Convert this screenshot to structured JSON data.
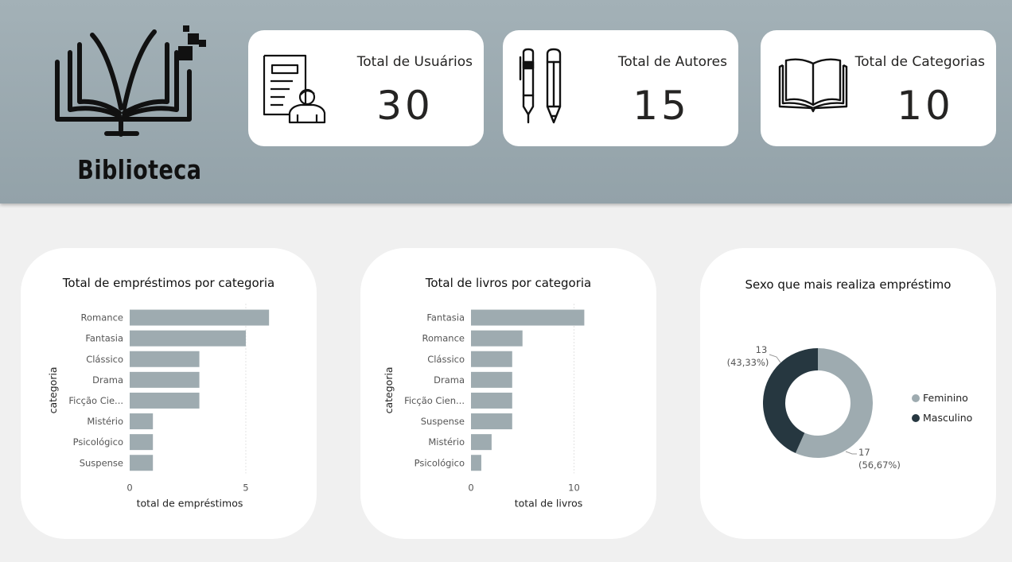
{
  "header": {
    "logo_text": "Biblioteca",
    "background_color": "#9eadb3"
  },
  "kpis": [
    {
      "label": "Total de Usuários",
      "value": "30",
      "icon": "user-document-icon"
    },
    {
      "label": "Total de Autores",
      "value": "15",
      "icon": "pen-pencil-icon"
    },
    {
      "label": "Total de Categorias",
      "value": "10",
      "icon": "open-book-icon"
    }
  ],
  "colors": {
    "bar": "#9eabb0",
    "feminino": "#9eabb0",
    "masculino": "#263740"
  },
  "chart_data": [
    {
      "type": "bar",
      "orientation": "horizontal",
      "title": "Total de empréstimos por categoria",
      "xlabel": "total de empréstimos",
      "ylabel": "categoria",
      "categories": [
        "Romance",
        "Fantasia",
        "Clássico",
        "Drama",
        "Ficção Cie...",
        "Mistério",
        "Psicológico",
        "Suspense"
      ],
      "values": [
        6,
        5,
        3,
        3,
        3,
        1,
        1,
        1
      ],
      "xticks": [
        0,
        5
      ],
      "xlim": [
        0,
        6.2
      ],
      "grid": true
    },
    {
      "type": "bar",
      "orientation": "horizontal",
      "title": "Total de livros por categoria",
      "xlabel": "total de livros",
      "ylabel": "categoria",
      "categories": [
        "Fantasia",
        "Romance",
        "Clássico",
        "Drama",
        "Ficção Cien...",
        "Suspense",
        "Mistério",
        "Psicológico"
      ],
      "values": [
        11,
        5,
        4,
        4,
        4,
        4,
        2,
        1
      ],
      "xticks": [
        0,
        10
      ],
      "xlim": [
        0,
        11.2
      ],
      "grid": true
    },
    {
      "type": "pie",
      "donut": true,
      "title": "Sexo que mais realiza empréstimo",
      "slices": [
        {
          "name": "Feminino",
          "value": 17,
          "label_value": "17",
          "label_percent": "(56,67%)"
        },
        {
          "name": "Masculino",
          "value": 13,
          "label_value": "13",
          "label_percent": "(43,33%)"
        }
      ],
      "legend": "right"
    }
  ]
}
